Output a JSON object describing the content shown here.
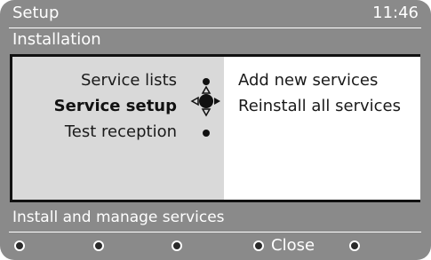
{
  "header": {
    "title": "Setup",
    "time": "11:46"
  },
  "subheader": {
    "title": "Installation"
  },
  "menu": {
    "items": [
      {
        "label": "Service lists",
        "selected": false
      },
      {
        "label": "Service setup",
        "selected": true
      },
      {
        "label": "Test reception",
        "selected": false
      }
    ]
  },
  "submenu": {
    "items": [
      {
        "label": "Add new services"
      },
      {
        "label": "Reinstall all services"
      }
    ]
  },
  "status": {
    "text": "Install and manage services"
  },
  "footer": {
    "buttons": [
      {
        "label": "",
        "icon": "red-button-icon"
      },
      {
        "label": "",
        "icon": "green-button-icon"
      },
      {
        "label": "",
        "icon": "yellow-button-icon"
      },
      {
        "label": "Close",
        "icon": "blue-button-icon"
      },
      {
        "label": "",
        "icon": "option-button-icon"
      }
    ]
  },
  "colors": {
    "background": "#8a8a8a",
    "panel_left": "#d9d9d9",
    "panel_right": "#ffffff",
    "text_light": "#ffffff",
    "text_dark": "#1a1a1a"
  }
}
